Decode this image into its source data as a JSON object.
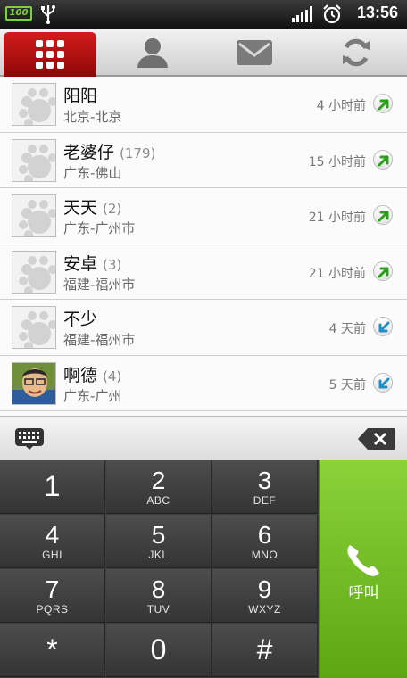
{
  "status_bar": {
    "battery": "100",
    "time": "13:56"
  },
  "tabs": [
    {
      "name": "dialer",
      "icon": "dialpad-grid-icon",
      "active": true
    },
    {
      "name": "contacts",
      "icon": "person-icon",
      "active": false
    },
    {
      "name": "messages",
      "icon": "envelope-icon",
      "active": false
    },
    {
      "name": "sync",
      "icon": "sync-icon",
      "active": false
    }
  ],
  "call_log": [
    {
      "name": "阳阳",
      "count": "",
      "location": "北京-北京",
      "time": "4 小时前",
      "type": "outgoing",
      "avatar": "default-avatar-icon"
    },
    {
      "name": "老婆仔",
      "count": "(179)",
      "location": "广东-佛山",
      "time": "15 小时前",
      "type": "outgoing",
      "avatar": "default-avatar-icon"
    },
    {
      "name": "天天",
      "count": "(2)",
      "location": "广东-广州市",
      "time": "21 小时前",
      "type": "outgoing",
      "avatar": "default-avatar-icon"
    },
    {
      "name": "安卓",
      "count": "(3)",
      "location": "福建-福州市",
      "time": "21 小时前",
      "type": "outgoing",
      "avatar": "default-avatar-icon"
    },
    {
      "name": "不少",
      "count": "",
      "location": "福建-福州市",
      "time": "4 天前",
      "type": "incoming",
      "avatar": "default-avatar-icon"
    },
    {
      "name": "啊德",
      "count": "(4)",
      "location": "广东-广州",
      "time": "5 天前",
      "type": "incoming",
      "avatar": "photo-avatar-icon"
    }
  ],
  "dialpad": {
    "keys": [
      {
        "digit": "1",
        "letters": ""
      },
      {
        "digit": "2",
        "letters": "ABC"
      },
      {
        "digit": "3",
        "letters": "DEF"
      },
      {
        "digit": "4",
        "letters": "GHI"
      },
      {
        "digit": "5",
        "letters": "JKL"
      },
      {
        "digit": "6",
        "letters": "MNO"
      },
      {
        "digit": "7",
        "letters": "PQRS"
      },
      {
        "digit": "8",
        "letters": "TUV"
      },
      {
        "digit": "9",
        "letters": "WXYZ"
      },
      {
        "digit": "*",
        "letters": ""
      },
      {
        "digit": "0",
        "letters": ""
      },
      {
        "digit": "#",
        "letters": ""
      }
    ],
    "call_label": "呼叫"
  },
  "colors": {
    "accent_red": "#b01010",
    "call_green": "#6fbb22",
    "outgoing_arrow": "#2e9e1e",
    "incoming_arrow": "#1f8fc8"
  }
}
